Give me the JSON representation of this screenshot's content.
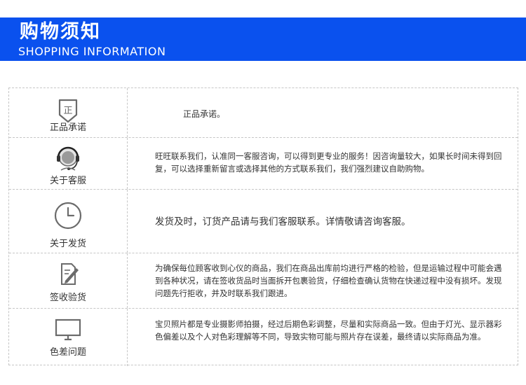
{
  "header": {
    "title": "购物须知",
    "subtitle": "SHOPPING INFORMATION"
  },
  "rows": [
    {
      "icon": "shield-zheng-icon",
      "badge": "正",
      "label": "正品承诺",
      "text": "正品承诺。"
    },
    {
      "icon": "customer-service-headset-icon",
      "label": "关于客服",
      "text": "旺旺联系我们，认准同一客服咨询，可以得到更专业的服务！因咨询量较大，如果长时间未得到回复，可以选择重新留言或选择其他的方式联系我们，我们强烈建议自助购物。"
    },
    {
      "icon": "clock-icon",
      "label": "关于发货",
      "text": "发货及时，订货产品请与我们客服联系。详情敬请咨询客服。"
    },
    {
      "icon": "document-sign-icon",
      "label": "签收验货",
      "text": "为确保每位顾客收到心仪的商品，我们在商品出库前均进行严格的检验，但是运输过程中可能会遇到各种状况，请在签收货品时当面拆开包裹验货，仔细检查确认货物在快递过程中没有损坏。发现问题先行拒收，并及时联系我们跟进。"
    },
    {
      "icon": "monitor-icon",
      "label": "色差问题",
      "text": "宝贝照片都是专业摄影师拍摄，经过后期色彩调整，尽量和实际商品一致。但由于灯光、显示器彩色偏差以及个人对色彩理解等不同，导致实物可能与照片存在误差，最终请以实际商品为准。"
    }
  ],
  "colors": {
    "banner": "#0a51ee",
    "icon_stroke": "#6b6b6b",
    "border": "#c6c6c6"
  }
}
